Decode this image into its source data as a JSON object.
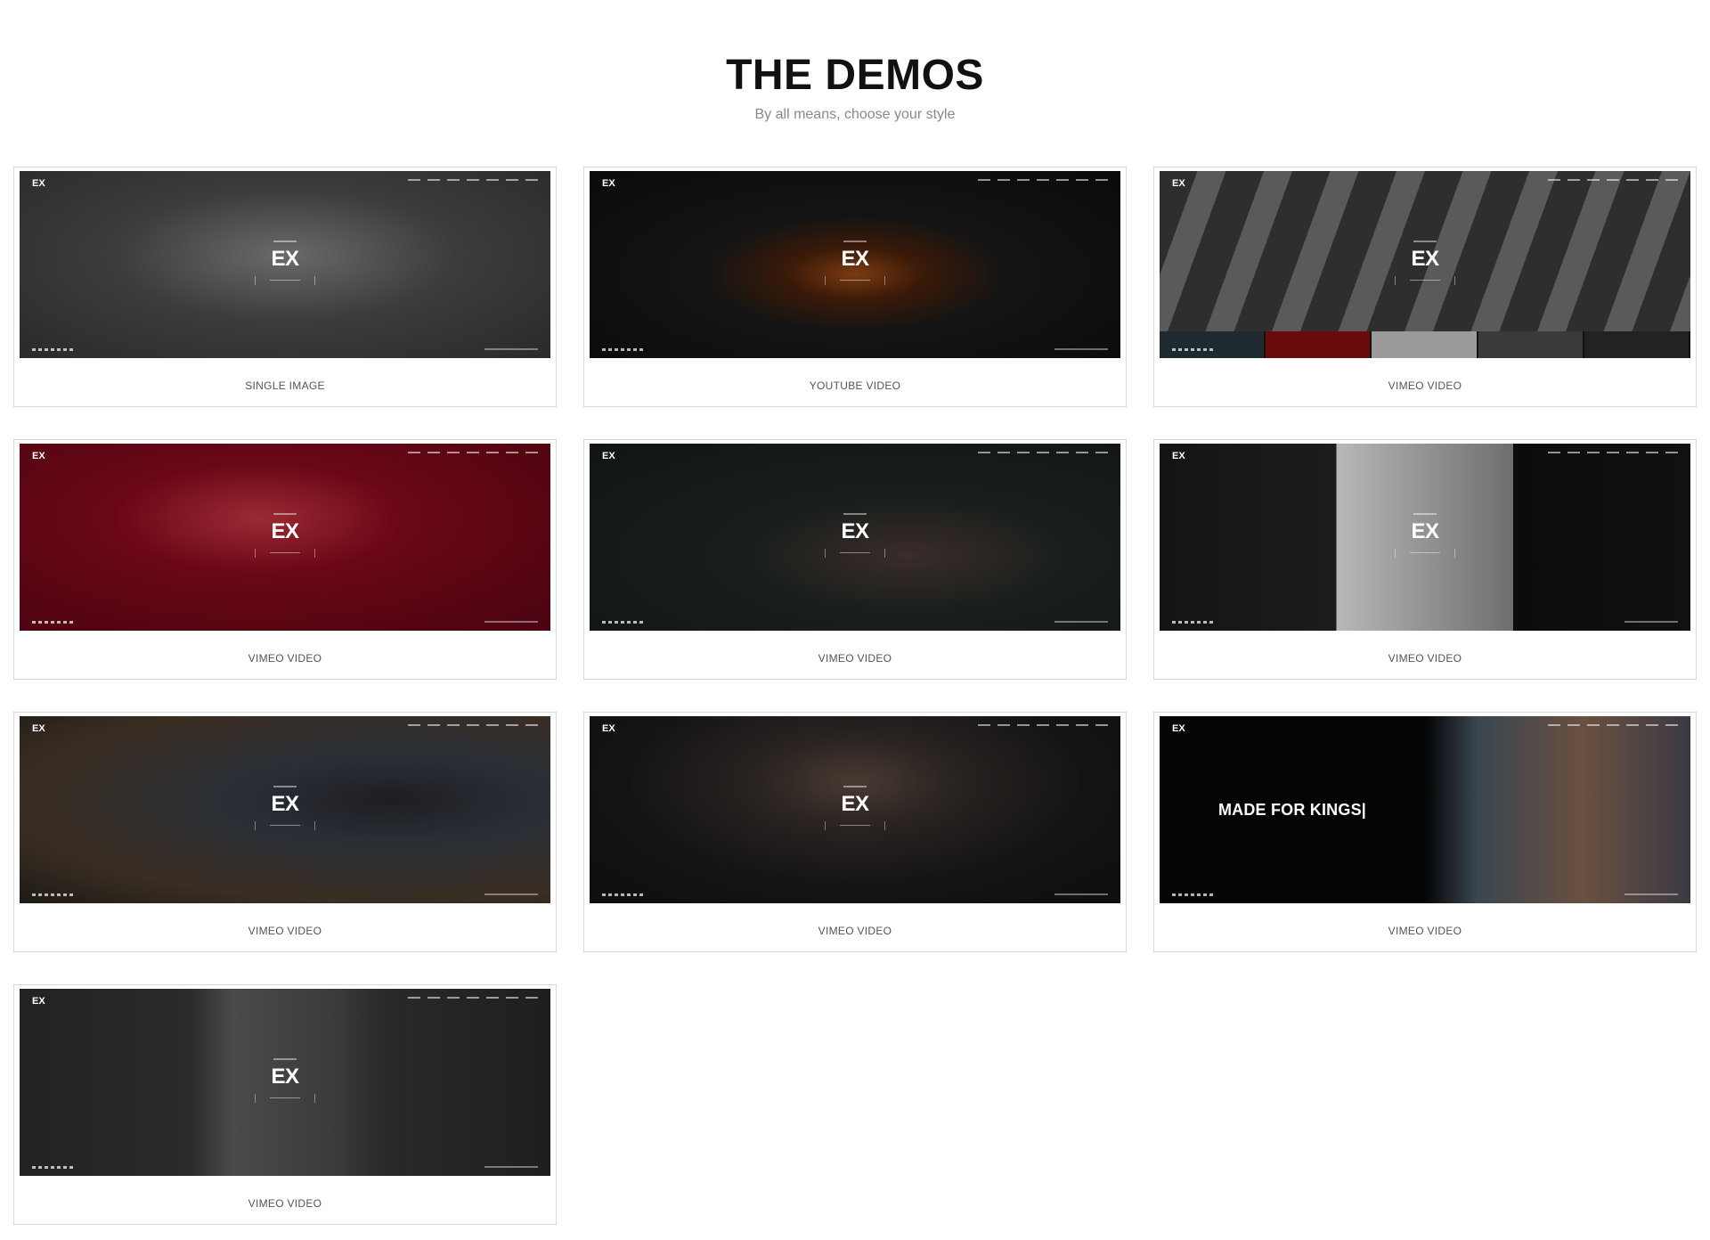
{
  "header": {
    "title": "THE DEMOS",
    "subtitle": "By all means, choose your style"
  },
  "thumbnail_text": {
    "logo": "EX",
    "brand": "EX",
    "kings_headline": "MADE FOR KINGS|"
  },
  "demos": [
    {
      "label": "SINGLE IMAGE"
    },
    {
      "label": "YOUTUBE VIDEO"
    },
    {
      "label": "VIMEO VIDEO"
    },
    {
      "label": "VIMEO VIDEO"
    },
    {
      "label": "VIMEO VIDEO"
    },
    {
      "label": "VIMEO VIDEO"
    },
    {
      "label": "VIMEO VIDEO"
    },
    {
      "label": "VIMEO VIDEO"
    },
    {
      "label": "VIMEO VIDEO"
    },
    {
      "label": "VIMEO VIDEO"
    }
  ]
}
